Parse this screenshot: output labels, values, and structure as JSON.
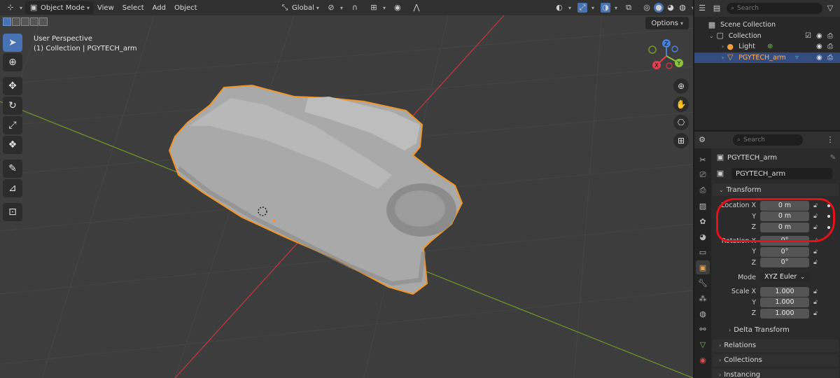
{
  "viewport": {
    "header": {
      "editor_icon": "globe-axes-icon",
      "mode_label": "Object Mode",
      "menus": [
        "View",
        "Select",
        "Add",
        "Object"
      ],
      "transform_orientation": "Global"
    },
    "options_label": "Options",
    "info": {
      "perspective": "User Perspective",
      "collection_line": "(1) Collection | PGYTECH_arm"
    },
    "gizmo": {
      "x": "X",
      "y": "Y",
      "z": "Z"
    },
    "colors": {
      "background": "#3d3d3d",
      "selection_outline": "#f0962a",
      "x_axis": "#c8353f",
      "y_axis": "#6f9a2a",
      "object": "#a8a8a8"
    }
  },
  "toolbar": {
    "tools": [
      "select-box-icon",
      "cursor-icon",
      "move-icon",
      "rotate-icon",
      "scale-icon",
      "transform-icon",
      "annotate-icon",
      "measure-icon",
      "add-cube-icon"
    ]
  },
  "outliner": {
    "search_placeholder": "Search",
    "rows": [
      {
        "label": "Scene Collection"
      },
      {
        "label": "Collection"
      },
      {
        "label": "Light"
      },
      {
        "label": "PGYTECH_arm"
      }
    ]
  },
  "properties": {
    "search_placeholder": "Search",
    "object_name": "PGYTECH_arm",
    "name_field": "PGYTECH_arm",
    "transform": {
      "title": "Transform",
      "location": {
        "label_x": "Location X",
        "label_y": "Y",
        "label_z": "Z",
        "x": "0 m",
        "y": "0 m",
        "z": "0 m"
      },
      "rotation": {
        "label_x": "Rotation X",
        "label_y": "Y",
        "label_z": "Z",
        "x": "0°",
        "y": "0°",
        "z": "0°"
      },
      "mode_label": "Mode",
      "mode_value": "XYZ Euler",
      "scale": {
        "label_x": "Scale X",
        "label_y": "Y",
        "label_z": "Z",
        "x": "1.000",
        "y": "1.000",
        "z": "1.000"
      },
      "delta": "Delta Transform"
    },
    "panels": [
      "Relations",
      "Collections",
      "Instancing"
    ],
    "annotation_color": "#e5101a"
  }
}
